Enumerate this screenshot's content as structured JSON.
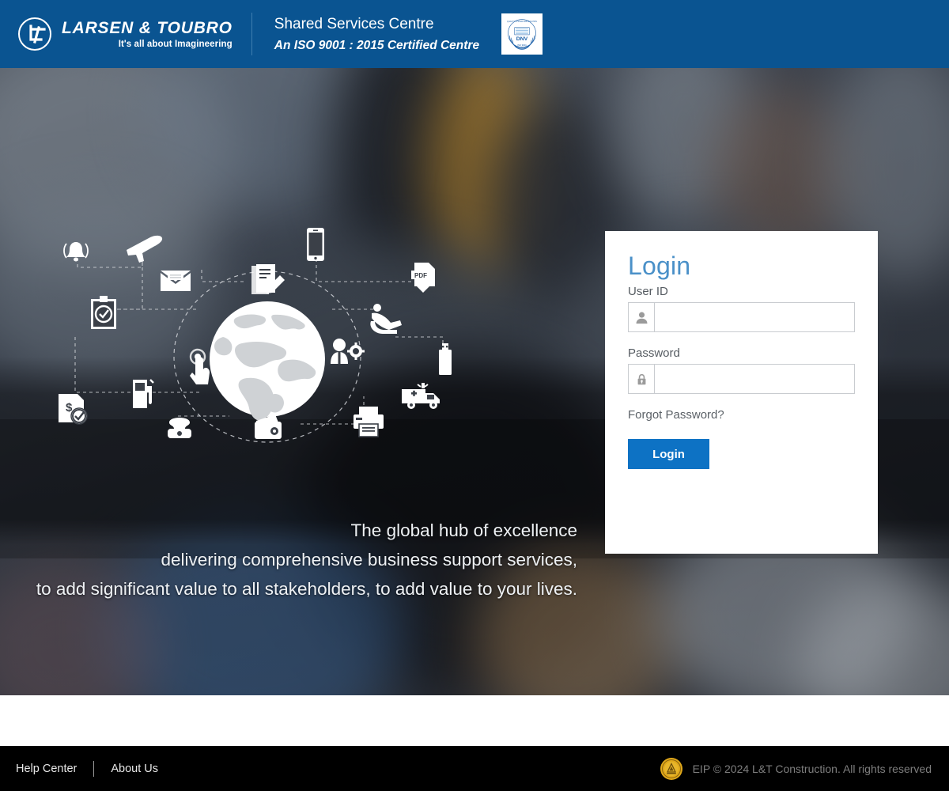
{
  "header": {
    "logo_icon": "lt-monogram-icon",
    "brand_name": "LARSEN & TOUBRO",
    "brand_tagline": "It's all about Imagineering",
    "title": "Shared Services Centre",
    "subtitle": "An ISO 9001 : 2015 Certified Centre",
    "badge": {
      "icon": "dnv-certification-badge-icon",
      "top_text": "QUALITY SYSTEM CERTIFICATION",
      "name": "DNV",
      "bottom_text": "ISO 9001"
    },
    "background_color": "#0a5491"
  },
  "hero": {
    "tagline_lines": [
      "The global hub of excellence",
      "delivering comprehensive business support services,",
      "to add significant value to all stakeholders, to add value to your lives."
    ],
    "graphic_icons": [
      "bell-icon",
      "airplane-icon",
      "envelope-icon",
      "mobile-phone-icon",
      "pdf-download-icon",
      "document-edit-icon",
      "clipboard-check-icon",
      "touch-pointer-icon",
      "globe-icon",
      "recliner-chair-icon",
      "user-settings-icon",
      "usb-drive-icon",
      "ambulance-icon",
      "printer-icon",
      "wallet-icon",
      "telephone-icon",
      "fuel-pump-icon",
      "invoice-dollar-check-icon"
    ]
  },
  "login": {
    "heading": "Login",
    "heading_color": "#4a90c8",
    "user_id": {
      "label": "User ID",
      "icon": "user-icon",
      "value": "",
      "placeholder": ""
    },
    "password": {
      "label": "Password",
      "icon": "lock-icon",
      "value": "",
      "placeholder": ""
    },
    "forgot_password_label": "Forgot Password?",
    "submit_label": "Login",
    "submit_color": "#0d72c4"
  },
  "footer": {
    "links": [
      {
        "label": "Help Center"
      },
      {
        "label": "About Us"
      }
    ],
    "seal_icon": "lt-construction-seal-icon",
    "copyright": "EIP © 2024 L&T Construction. All rights reserved",
    "background_color": "#000000"
  }
}
